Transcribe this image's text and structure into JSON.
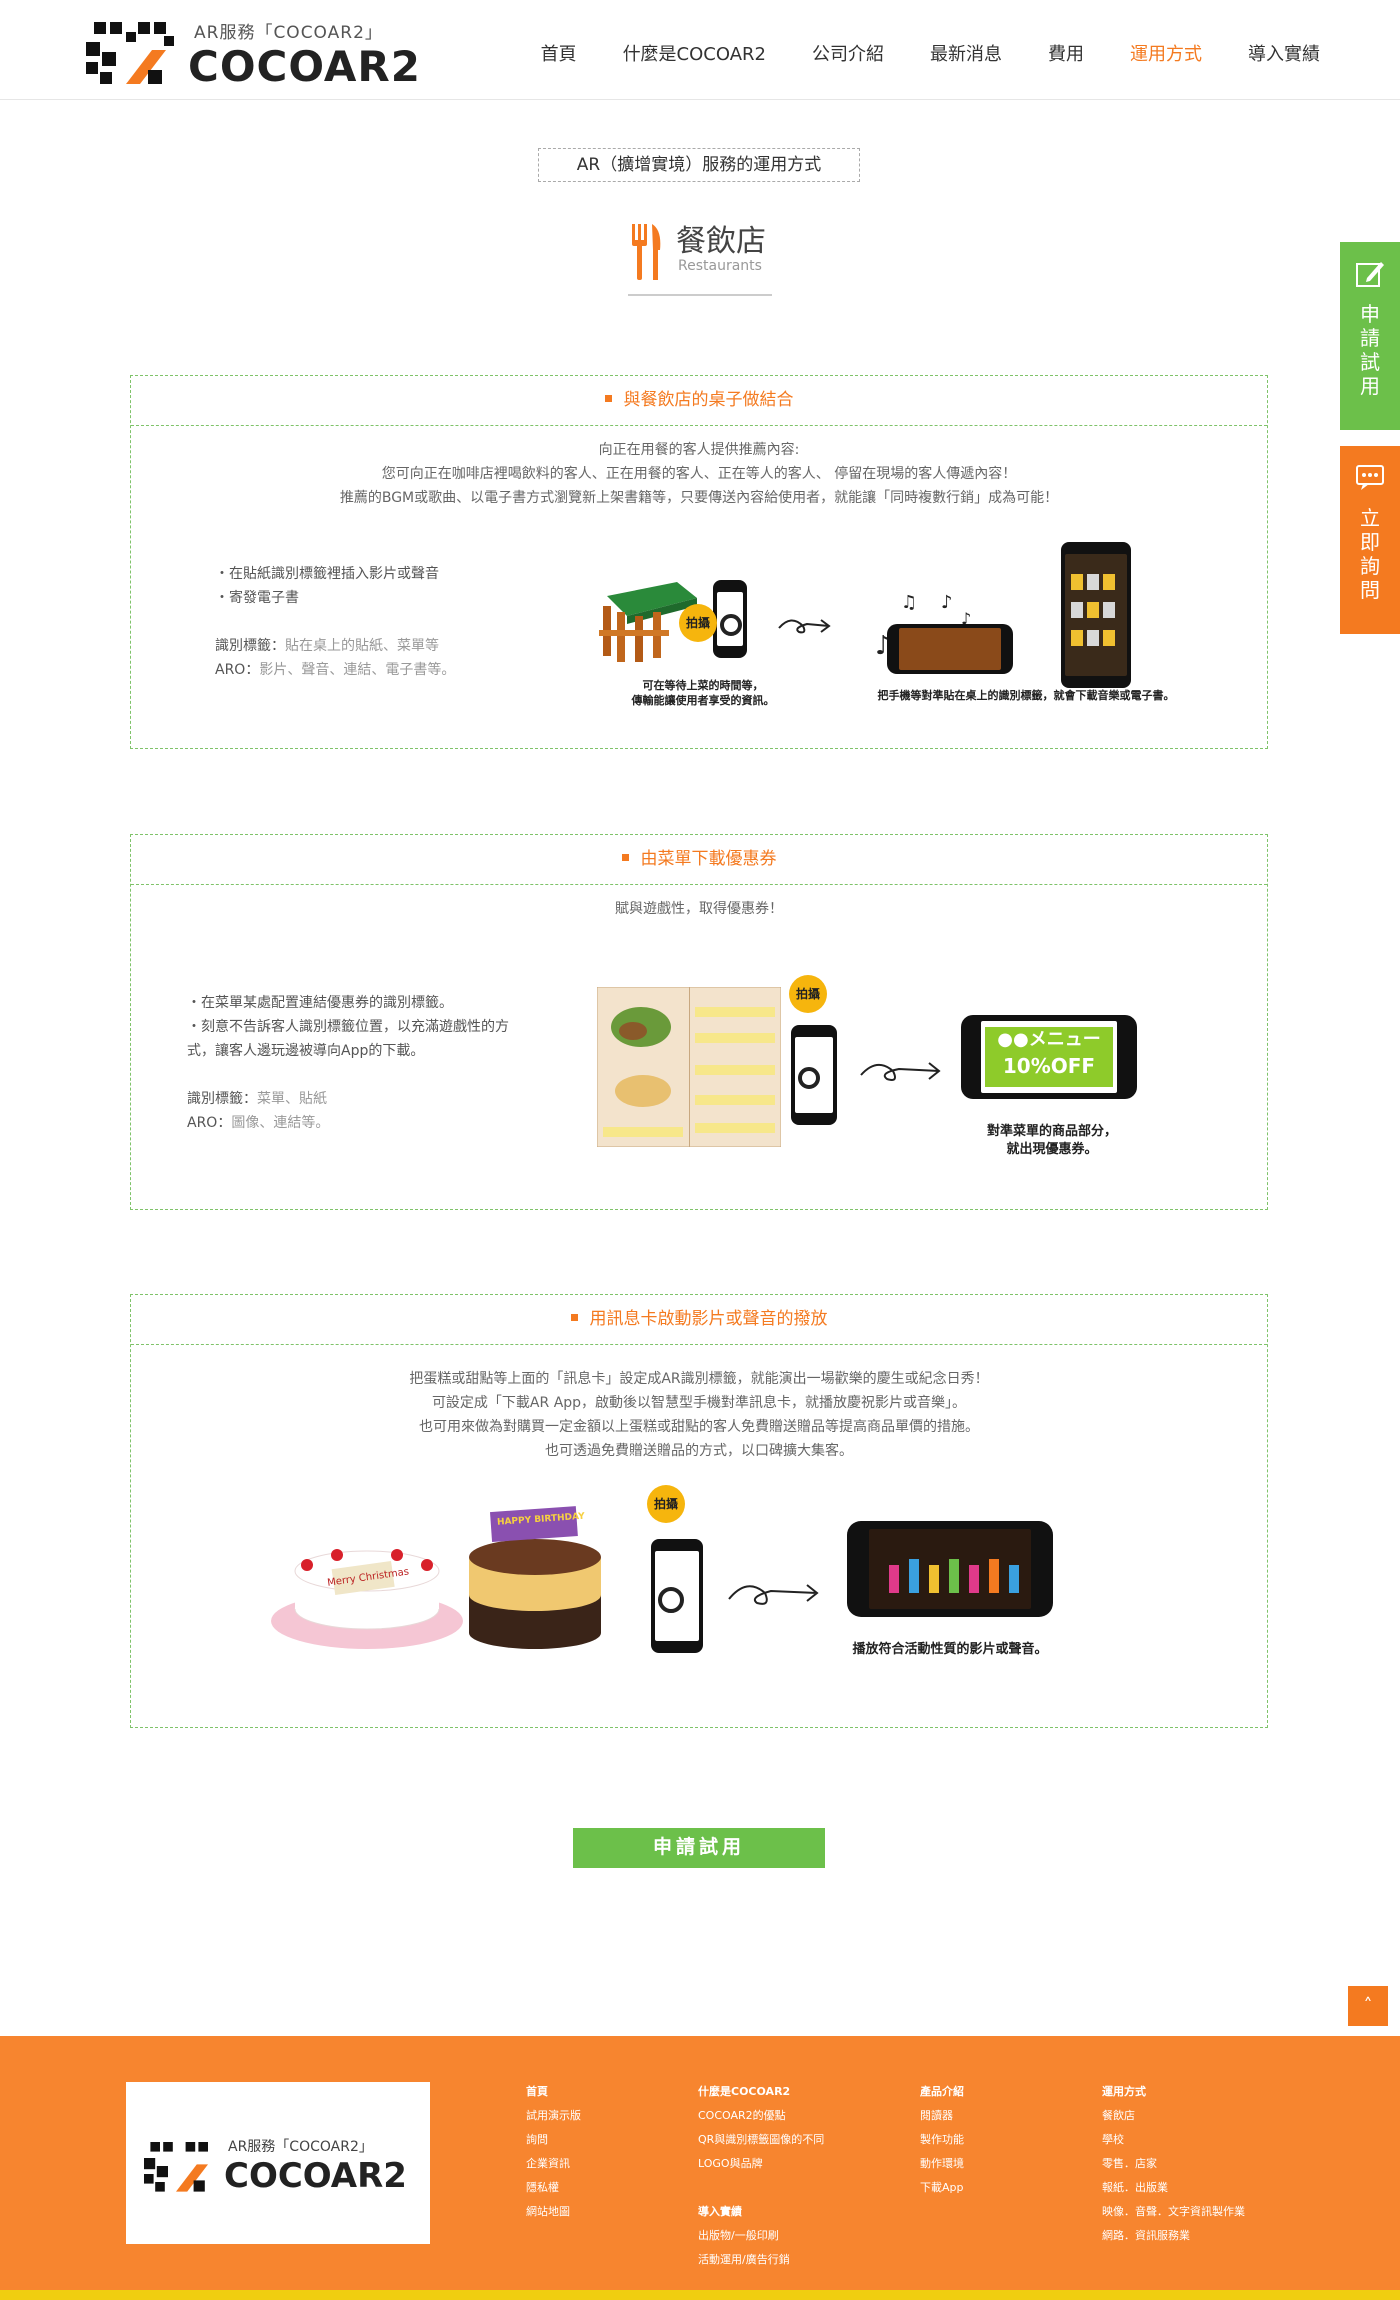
{
  "header": {
    "logo_sub": "AR服務「COCOAR2」",
    "logo_main": "COCOAR2",
    "nav": [
      "首頁",
      "什麼是COCOAR2",
      "公司介紹",
      "最新消息",
      "費用",
      "運用方式",
      "導入實績"
    ],
    "active_nav": "運用方式"
  },
  "page": {
    "tag": "AR（擴增實境）服務的運用方式",
    "category_title": "餐飲店",
    "category_en": "Restaurants"
  },
  "sections": [
    {
      "title": "與餐飲店的桌子做結合",
      "intro": [
        "向正在用餐的客人提供推薦內容:",
        "您可向正在咖啡店裡喝飲料的客人、正在用餐的客人、正在等人的客人、 停留在現場的客人傳遞內容！",
        "推薦的BGM或歌曲、以電子書方式瀏覽新上架書籍等，只要傳送內容給使用者，就能讓「同時複數行銷」成為可能！"
      ],
      "bullets": [
        "・在貼紙識別標籤裡插入影片或聲音",
        "・寄發電子書"
      ],
      "marker_label": "識別標籤：",
      "marker_value": "貼在桌上的貼紙、菜單等",
      "aro_label": "ARO：",
      "aro_value": "影片、聲音、連結、電子書等。",
      "badge": "拍攝",
      "caption_left": [
        "可在等待上菜的時間等，",
        "傳輸能讓使用者享受的資訊。"
      ],
      "caption_right": "把手機等對準貼在桌上的識別標籤，就會下載音樂或電子書。"
    },
    {
      "title": "由菜單下載優惠券",
      "intro": [
        "賦與遊戲性，取得優惠券！"
      ],
      "bullets": [
        "・在菜單某處配置連結優惠券的識別標籤。",
        "・刻意不告訴客人識別標籤位置，以充滿遊戲性的方",
        "式，讓客人邊玩邊被導向App的下載。"
      ],
      "marker_label": "識別標籤：",
      "marker_value": "菜單、貼紙",
      "aro_label": "ARO：",
      "aro_value": "圖像、連結等。",
      "badge": "拍攝",
      "coupon_line1": "●●メニュー",
      "coupon_line2": "10%OFF",
      "caption_right": [
        "對準菜單的商品部分，",
        "就出現優惠券。"
      ]
    },
    {
      "title": "用訊息卡啟動影片或聲音的撥放",
      "intro": [
        "把蛋糕或甜點等上面的「訊息卡」設定成AR識別標籤，就能演出一場歡樂的慶生或紀念日秀！",
        "可設定成「下載AR App，啟動後以智慧型手機對準訊息卡，就播放慶祝影片或音樂」。",
        "也可用來做為對購買一定金額以上蛋糕或甜點的客人免費贈送贈品等提高商品單價的措施。",
        "也可透過免費贈送贈品的方式，以口碑擴大集客。"
      ],
      "badge": "拍攝",
      "cake1_text": "Merry Christmas",
      "cake2_text": "HAPPY BIRTHDAY",
      "caption_right": "播放符合活動性質的影片或聲音。"
    }
  ],
  "apply_button": "申請試用",
  "side": {
    "apply": [
      "申",
      "請",
      "試",
      "用"
    ],
    "ask": [
      "立",
      "即",
      "詢",
      "問"
    ]
  },
  "to_top": "˄",
  "footer": {
    "logo_sub": "AR服務「COCOAR2」",
    "logo_main": "COCOAR2",
    "col1": [
      "首頁",
      "試用演示版",
      "詢問",
      "企業資訊",
      "隱私權",
      "網站地圖"
    ],
    "col2_head": "什麼是COCOAR2",
    "col2": [
      "COCOAR2的優點",
      "QR與識別標籤圖像的不同",
      "LOGO與品牌"
    ],
    "col2b_head": "導入實績",
    "col2b": [
      "出版物/一般印刷",
      "活動運用/廣告行銷"
    ],
    "col3_head": "產品介紹",
    "col3": [
      "閱讀器",
      "製作功能",
      "動作環境",
      "下載App"
    ],
    "col4_head": "運用方式",
    "col4": [
      "餐飲店",
      "學校",
      "零售．店家",
      "報紙．出版業",
      "映像．音聲．文字資訊製作業",
      "網路．資訊服務業"
    ]
  },
  "colors": {
    "accent_orange": "#f47a20",
    "accent_green": "#6cc04a",
    "footer_orange": "#f7852f",
    "footer_yellow": "#f0ce10"
  }
}
